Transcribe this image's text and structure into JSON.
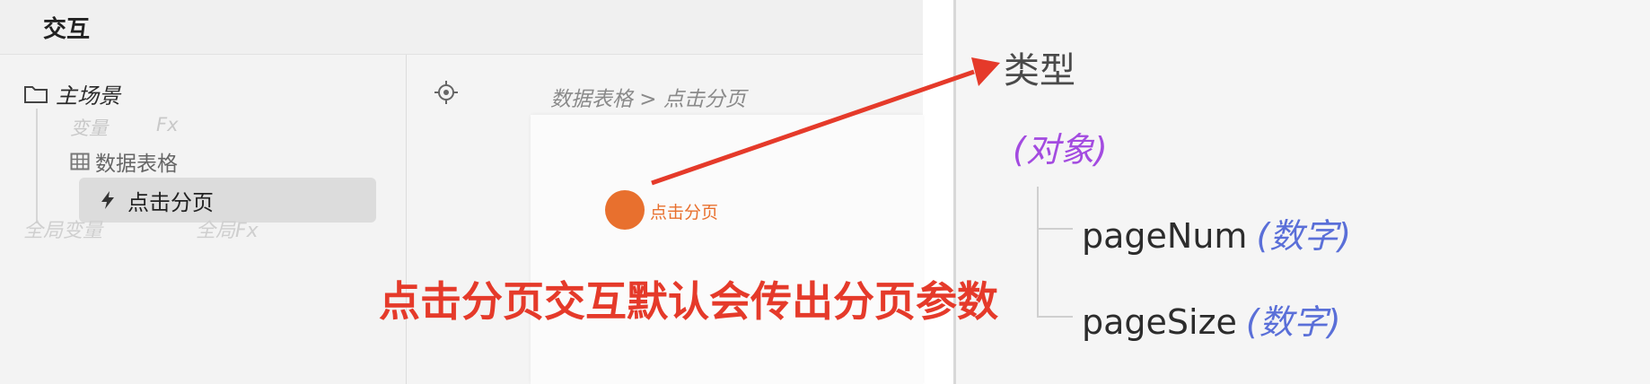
{
  "header": {
    "title": "交互"
  },
  "tree": {
    "root_label": "主场景",
    "variable_label": "变量",
    "fx_label": "Fx",
    "table_label": "数据表格",
    "selected_label": "点击分页",
    "global_variable_label": "全局变量",
    "global_fx_label": "全局Fx"
  },
  "canvas": {
    "breadcrumb": "数据表格 > 点击分页",
    "event_label": "点击分页"
  },
  "annotation": {
    "text": "点击分页交互默认会传出分页参数"
  },
  "type_panel": {
    "title": "类型",
    "object_type": "(对象)",
    "params": [
      {
        "name": "pageNum",
        "type": "(数字)"
      },
      {
        "name": "pageSize",
        "type": "(数字)"
      }
    ]
  },
  "colors": {
    "accent_orange": "#e8702e",
    "annotation_red": "#e53a2a",
    "object_purple": "#a34be0",
    "type_blue": "#5a6fd8"
  },
  "icons": [
    "folder-icon",
    "table-icon",
    "bolt-icon",
    "target-icon"
  ]
}
